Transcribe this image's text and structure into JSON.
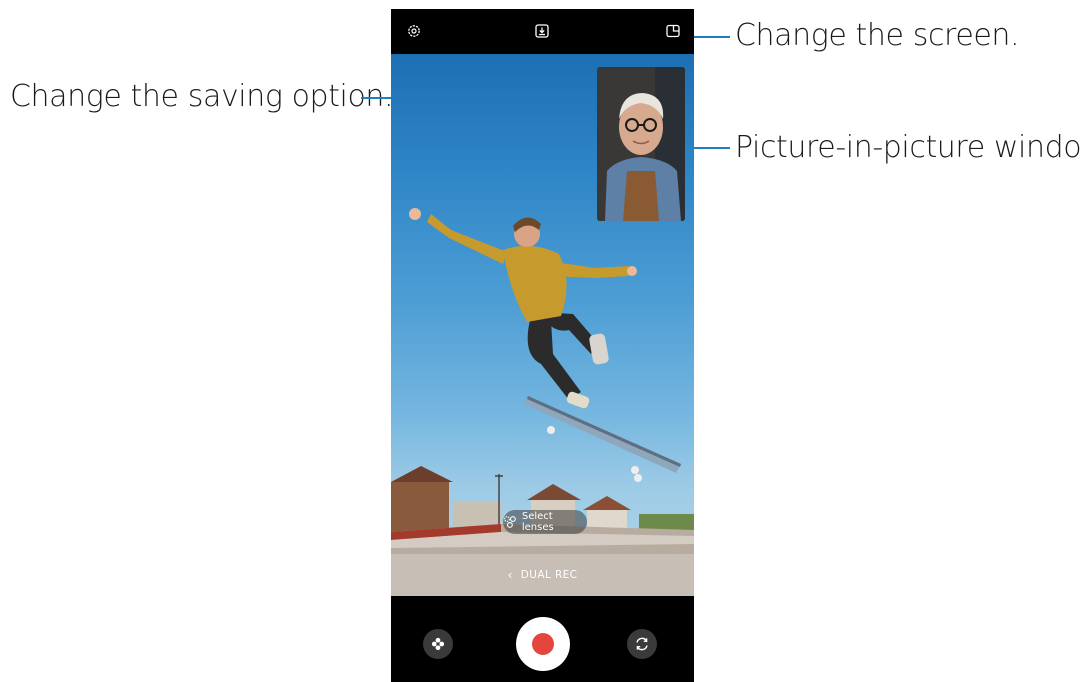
{
  "callouts": {
    "saving_option": "Change the saving option.",
    "change_screen": "Change the screen.",
    "pip_window": "Picture-in-picture window"
  },
  "camera": {
    "lens_selector_label": "Select lenses",
    "mode_label": "DUAL REC",
    "record_color": "#e4463d",
    "accent_color": "#1e7fbf",
    "icons": {
      "settings": "gear-icon",
      "saving_option": "download-box-icon",
      "screen_layout": "split-screen-icon",
      "lens": "multi-lens-icon",
      "mode_back": "chevron-left-icon",
      "effects": "flower-icon",
      "record": "record-dot-icon",
      "switch_camera": "rotate-camera-icon"
    }
  }
}
